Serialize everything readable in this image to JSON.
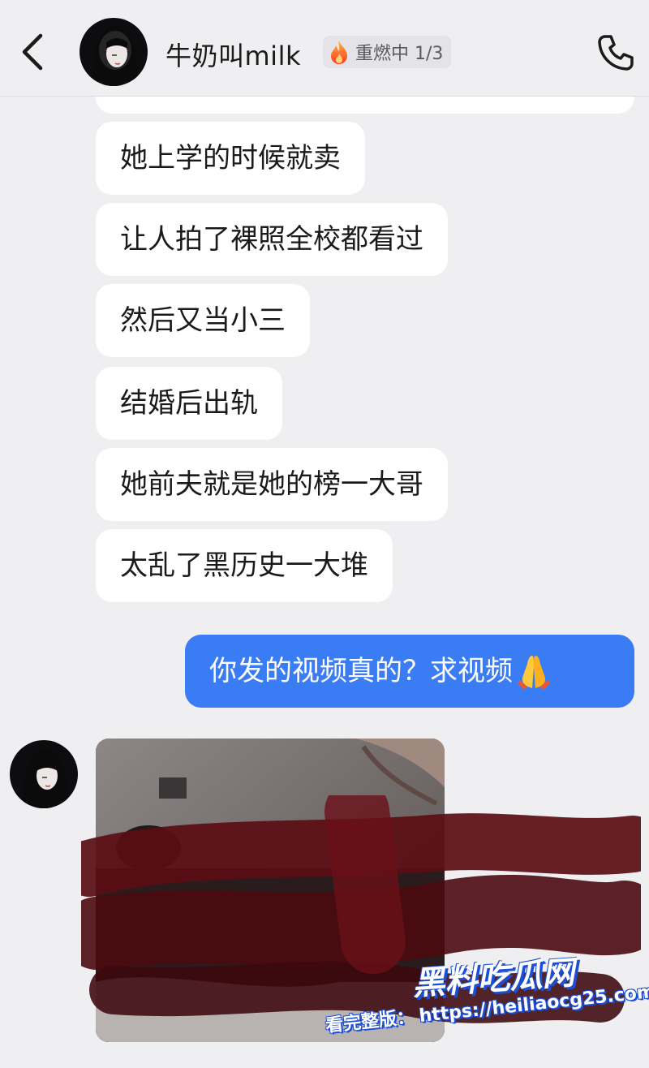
{
  "header": {
    "contact_name": "牛奶叫milk",
    "reignite_label": "重燃中 1/3"
  },
  "messages": {
    "incoming": [
      "她上学的时候就卖",
      "让人拍了裸照全校都看过",
      "然后又当小三",
      "结婚后出轨",
      "她前夫就是她的榜一大哥",
      "太乱了黑历史一大堆"
    ],
    "outgoing_text": "你发的视频真的？求视频"
  },
  "watermark": {
    "brand": "黑料吃瓜网",
    "prefix": "看完整版：",
    "url": "https://heiliaocg25.com"
  },
  "colors": {
    "background": "#efeff1",
    "outgoing_bubble": "#3a7cf4",
    "incoming_bubble": "#ffffff"
  }
}
